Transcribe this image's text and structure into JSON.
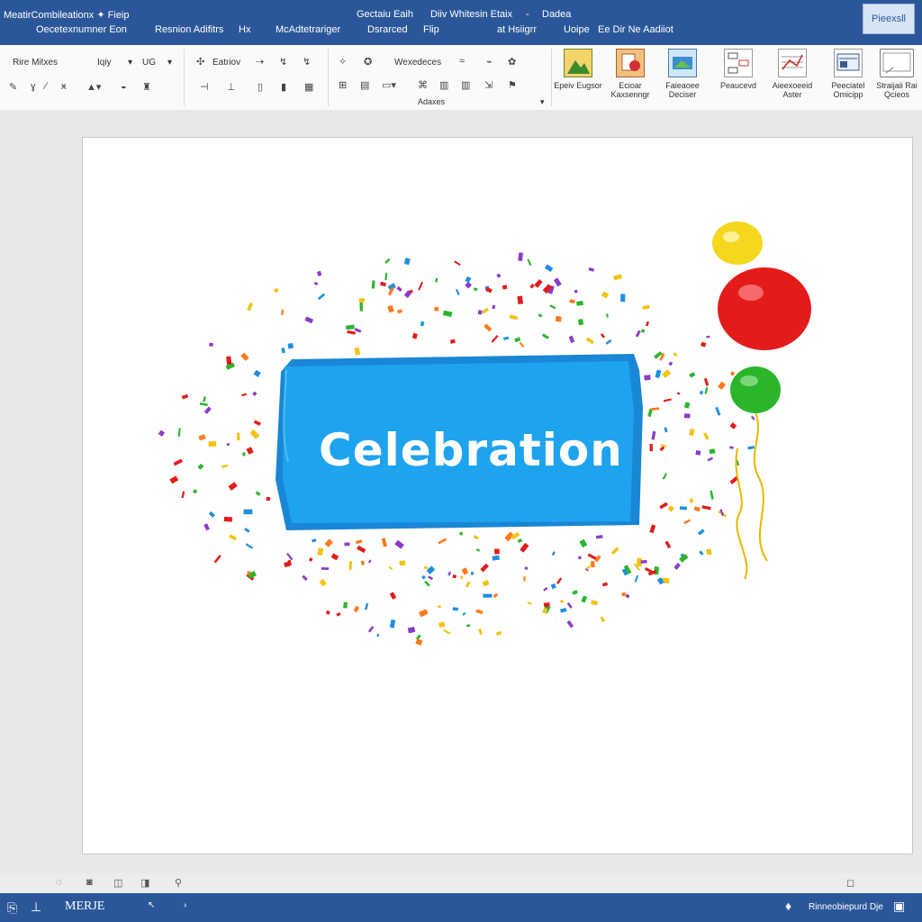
{
  "titlebar": {
    "app_title": "MeatirCombileationx ✦ Fieip",
    "tab_left": "Oecetexnumner Eon",
    "tab_center_1": "Gectaiu  Eaih",
    "tab_center_2": "Diiv Whitesin Etaix",
    "tab_right_1": "Dadea",
    "share": "Pieexsll",
    "menu": [
      "Resnion Adifitrs",
      "Hx",
      "McAdtetrariger",
      "Dsrarced",
      "Flip",
      "at Hsiigrr",
      "Uoipe",
      "Ee Dir Ne Aadiiot"
    ]
  },
  "ribbon": {
    "font_name": "Rire Mitxes",
    "font_size": "Iqiy",
    "font_ctrl": "UG",
    "para_label": "Eatriov",
    "styles_label": "Wexedeces",
    "group_label": "Adaxes",
    "buttons": [
      {
        "label": "Epeiv Eugsor",
        "icon": "picture-icon"
      },
      {
        "label": "Ecioar Kaxsenngr",
        "icon": "clipart-icon"
      },
      {
        "label": "Faieaoee Deciser",
        "icon": "shapes-icon"
      },
      {
        "label": "Peaucevd",
        "icon": "smartart-icon"
      },
      {
        "label": "Aieexoeeid Aster",
        "icon": "chart-icon"
      },
      {
        "label": "Peeciatel Omicipp",
        "icon": "screenshot-icon"
      },
      {
        "label": "Straijaii Rai Qcieos",
        "icon": "textbox-icon"
      }
    ]
  },
  "document": {
    "banner_text": "Celebration"
  },
  "statusbar": {
    "mode": "MERJE",
    "right_text": "Rinneobiepurd Dje"
  },
  "colors": {
    "accent": "#2b579a",
    "banner": "#1e9be9",
    "balloon_red": "#e31b1b",
    "balloon_green": "#2bbd2b",
    "balloon_yellow": "#f2d516"
  }
}
